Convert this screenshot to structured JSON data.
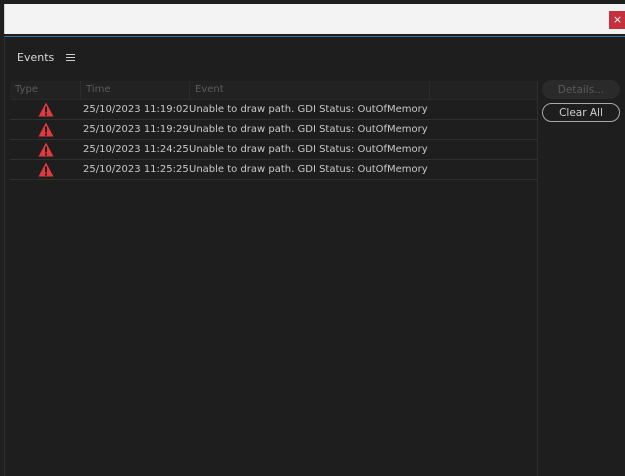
{
  "window": {
    "close_label": "×"
  },
  "panel": {
    "title": "Events",
    "menu_icon": "hamburger-menu-icon"
  },
  "table": {
    "columns": [
      "Type",
      "Time",
      "Event"
    ],
    "rows": [
      {
        "type_icon": "warning-icon",
        "time": "25/10/2023 11:19:02",
        "event": "Unable to draw path. GDI Status: OutOfMemory"
      },
      {
        "type_icon": "warning-icon",
        "time": "25/10/2023 11:19:29",
        "event": "Unable to draw path. GDI Status: OutOfMemory"
      },
      {
        "type_icon": "warning-icon",
        "time": "25/10/2023 11:24:25",
        "event": "Unable to draw path. GDI Status: OutOfMemory"
      },
      {
        "type_icon": "warning-icon",
        "time": "25/10/2023 11:25:25",
        "event": "Unable to draw path. GDI Status: OutOfMemory"
      }
    ]
  },
  "buttons": {
    "details": "Details...",
    "clear_all": "Clear All"
  },
  "colors": {
    "warning_red": "#e03a3e",
    "close_red": "#c4303c",
    "accent_blue": "#3a6fa8"
  }
}
